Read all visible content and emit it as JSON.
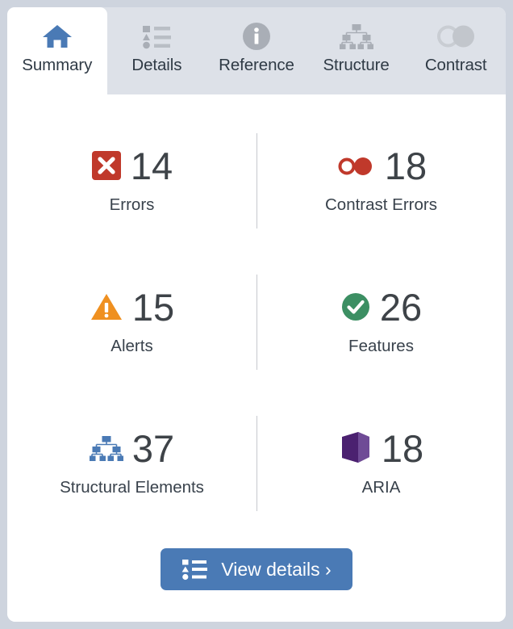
{
  "panel": {
    "background": "#ffffff",
    "page_background": "#ced4de"
  },
  "tabs": [
    {
      "label": "Summary",
      "icon": "home-icon",
      "active": true,
      "icon_color": "#4a7ab5"
    },
    {
      "label": "Details",
      "icon": "list-icon",
      "active": false,
      "icon_color": "#a9aeb6"
    },
    {
      "label": "Reference",
      "icon": "info-icon",
      "active": false,
      "icon_color": "#a9aeb6"
    },
    {
      "label": "Structure",
      "icon": "structure-icon",
      "active": false,
      "icon_color": "#a9aeb6"
    },
    {
      "label": "Contrast",
      "icon": "contrast-icon",
      "active": false,
      "icon_color": "#c2c6cc"
    }
  ],
  "stats": [
    [
      {
        "label": "Errors",
        "value": "14",
        "icon": "error-icon",
        "color": "#c0392b"
      },
      {
        "label": "Contrast Errors",
        "value": "18",
        "icon": "contrast-error-icon",
        "color": "#c0392b"
      }
    ],
    [
      {
        "label": "Alerts",
        "value": "15",
        "icon": "alert-icon",
        "color": "#ef9020"
      },
      {
        "label": "Features",
        "value": "26",
        "icon": "feature-icon",
        "color": "#3c8f63"
      }
    ],
    [
      {
        "label": "Structural Elements",
        "value": "37",
        "icon": "structure-blue-icon",
        "color": "#4a7ab5"
      },
      {
        "label": "ARIA",
        "value": "18",
        "icon": "aria-cube-icon",
        "color": "#5b2d82"
      }
    ]
  ],
  "footer": {
    "view_details_label": "View details ›",
    "view_details_icon": "list-icon",
    "button_color": "#4a7ab5"
  }
}
